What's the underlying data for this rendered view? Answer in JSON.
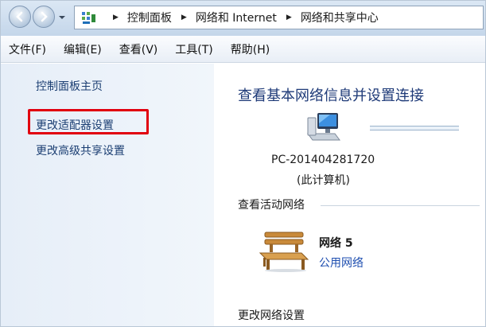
{
  "breadcrumbs": [
    "控制面板",
    "网络和 Internet",
    "网络和共享中心"
  ],
  "menu": [
    "文件(F)",
    "编辑(E)",
    "查看(V)",
    "工具(T)",
    "帮助(H)"
  ],
  "left_links": [
    "控制面板主页",
    "更改适配器设置",
    "更改高级共享设置"
  ],
  "main": {
    "title": "查看基本网络信息并设置连接",
    "computer_name": "PC-201404281720",
    "computer_sub": "(此计算机)",
    "active_networks_heading": "查看活动网络",
    "network_name": "网络  5",
    "network_type": "公用网络",
    "change_settings_heading": "更改网络设置"
  },
  "icons": {
    "back": "back-arrow-icon",
    "forward": "forward-arrow-icon",
    "control_panel": "control-panel-icon",
    "computer": "computer-icon",
    "network": "bench-network-icon"
  },
  "colors": {
    "link": "#1c3f73",
    "title": "#1e3a78",
    "highlight": "#e1000f",
    "network_type": "#1f4fb0"
  }
}
